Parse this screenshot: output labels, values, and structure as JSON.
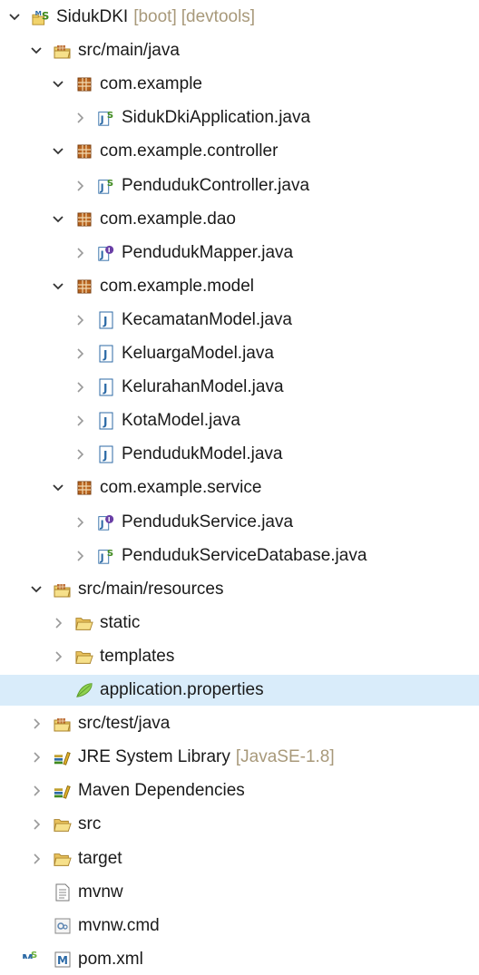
{
  "tree": {
    "nodes": [
      {
        "label": "SidukDKI",
        "decorations": [
          "[boot]",
          "[devtools]"
        ],
        "icon": "spring-project-icon",
        "expanded": true,
        "level": 0
      },
      {
        "label": "src/main/java",
        "icon": "source-folder-icon",
        "expanded": true,
        "level": 1
      },
      {
        "label": "com.example",
        "icon": "package-icon",
        "expanded": true,
        "level": 2
      },
      {
        "label": "SidukDkiApplication.java",
        "icon": "spring-java-file-icon",
        "expanded": false,
        "level": 3
      },
      {
        "label": "com.example.controller",
        "icon": "package-icon",
        "expanded": true,
        "level": 2
      },
      {
        "label": "PendudukController.java",
        "icon": "spring-java-file-icon",
        "expanded": false,
        "level": 3
      },
      {
        "label": "com.example.dao",
        "icon": "package-icon",
        "expanded": true,
        "level": 2
      },
      {
        "label": "PendudukMapper.java",
        "icon": "java-interface-file-icon",
        "expanded": false,
        "level": 3
      },
      {
        "label": "com.example.model",
        "icon": "package-icon",
        "expanded": true,
        "level": 2
      },
      {
        "label": "KecamatanModel.java",
        "icon": "java-file-icon",
        "expanded": false,
        "level": 3
      },
      {
        "label": "KeluargaModel.java",
        "icon": "java-file-icon",
        "expanded": false,
        "level": 3
      },
      {
        "label": "KelurahanModel.java",
        "icon": "java-file-icon",
        "expanded": false,
        "level": 3
      },
      {
        "label": "KotaModel.java",
        "icon": "java-file-icon",
        "expanded": false,
        "level": 3
      },
      {
        "label": "PendudukModel.java",
        "icon": "java-file-icon",
        "expanded": false,
        "level": 3
      },
      {
        "label": "com.example.service",
        "icon": "package-icon",
        "expanded": true,
        "level": 2
      },
      {
        "label": "PendudukService.java",
        "icon": "java-interface-file-icon",
        "expanded": false,
        "level": 3
      },
      {
        "label": "PendudukServiceDatabase.java",
        "icon": "spring-java-file-icon",
        "expanded": false,
        "level": 3
      },
      {
        "label": "src/main/resources",
        "icon": "source-folder-icon",
        "expanded": true,
        "level": 1
      },
      {
        "label": "static",
        "icon": "folder-icon",
        "expanded": false,
        "level": 2
      },
      {
        "label": "templates",
        "icon": "folder-icon",
        "expanded": false,
        "level": 2
      },
      {
        "label": "application.properties",
        "icon": "properties-file-icon",
        "leaf": true,
        "selected": true,
        "level": 2
      },
      {
        "label": "src/test/java",
        "icon": "source-folder-icon",
        "expanded": false,
        "level": 1
      },
      {
        "label": "JRE System Library",
        "decorations": [
          "[JavaSE-1.8]"
        ],
        "icon": "library-icon",
        "expanded": false,
        "level": 1
      },
      {
        "label": "Maven Dependencies",
        "icon": "library-icon",
        "expanded": false,
        "level": 1
      },
      {
        "label": "src",
        "icon": "folder-icon",
        "expanded": false,
        "level": 1
      },
      {
        "label": "target",
        "icon": "folder-icon",
        "expanded": false,
        "level": 1
      },
      {
        "label": "mvnw",
        "icon": "text-file-icon",
        "leaf": true,
        "level": 1
      },
      {
        "label": "mvnw.cmd",
        "icon": "script-file-icon",
        "leaf": true,
        "level": 1
      },
      {
        "label": "pom.xml",
        "icon": "maven-pom-icon",
        "leaf": true,
        "level": 1
      }
    ]
  },
  "colors": {
    "selection_bg": "#d9ecfa",
    "decoration_text": "#a8997a",
    "package_brown": "#8b4513",
    "folder_yellow": "#e8c15c",
    "java_blue": "#2c6aa6",
    "spring_green": "#6db33f"
  }
}
